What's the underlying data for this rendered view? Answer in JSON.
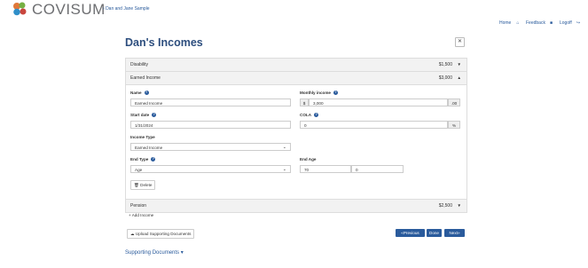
{
  "header": {
    "logo_text": "COVISUM",
    "breadcrumb": "Dan and Jane Sample",
    "nav": {
      "home": "Home",
      "feedback": "Feedback",
      "logoff": "Logoff"
    }
  },
  "page": {
    "title": "Dan's Incomes"
  },
  "incomes": {
    "disability": {
      "label": "Disability",
      "amount": "$1,500"
    },
    "earned": {
      "label": "Earned Income",
      "amount": "$3,000",
      "name_label": "Name",
      "name_value": "Earned Income",
      "monthly_label": "Monthly income",
      "monthly_prefix": "$",
      "monthly_value": "3,000",
      "monthly_suffix": ".00",
      "start_label": "Start date",
      "start_value": "1/31/2024",
      "cola_label": "COLA",
      "cola_value": "0",
      "cola_suffix": "%",
      "type_label": "Income Type",
      "type_value": "Earned Income",
      "endtype_label": "End Type",
      "endtype_value": "Age",
      "endage_label": "End Age",
      "endage_years": "70",
      "endage_months": "0",
      "delete_label": "Delete"
    },
    "pension": {
      "label": "Pension",
      "amount": "$2,500"
    }
  },
  "actions": {
    "add_income": "Add Income",
    "upload": "Upload Supporting Documents",
    "previous": "Previous",
    "done": "Done",
    "next": "Next"
  },
  "supporting_docs": "Supporting Documents",
  "colors": {
    "brand_blue": "#2a5b9c",
    "title_blue": "#2d4e7e"
  }
}
